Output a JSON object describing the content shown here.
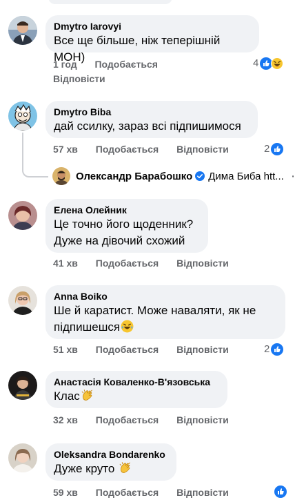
{
  "top_edge": {
    "visible": true
  },
  "comments": [
    {
      "author": "Dmytro Iarovyi",
      "text": "Все ще більше, ніж теперішній МОН)",
      "time": "1 год",
      "like": "Подобається",
      "reply": "Відповісти",
      "reactions": "4",
      "reaction_icons": [
        "like-icon",
        "haha-icon"
      ]
    },
    {
      "author": "Dmytro Biba",
      "text": "дай ссилку, зараз всі підпишимося",
      "time": "57 хв",
      "like": "Подобається",
      "reply": "Відповісти",
      "reactions": "2",
      "reaction_icons": [
        "like-icon"
      ],
      "reply_preview": {
        "author": "Олександр Барабошко",
        "verified": true,
        "text": "Дима Биба htt...",
        "more": "···"
      }
    },
    {
      "author": "Елена Олейник",
      "text_lines": [
        "Це точно його щоденник?",
        "Дуже на дівочий схожий"
      ],
      "time": "41 хв",
      "like": "Подобається",
      "reply": "Відповісти"
    },
    {
      "author": "Anna Boiko",
      "text_lines": [
        "Ше й каратист. Може наваляти, як не",
        "підпишешся"
      ],
      "emoji": "laugh-emoji",
      "time": "51 хв",
      "like": "Подобається",
      "reply": "Відповісти",
      "reactions": "2",
      "reaction_icons": [
        "like-icon"
      ]
    },
    {
      "author": "Анастасія Коваленко-В'язовська",
      "text": "Клас",
      "emoji": "clap-emoji",
      "time": "32 хв",
      "like": "Подобається",
      "reply": "Відповісти"
    },
    {
      "author": "Oleksandra Bondarenko",
      "text": "Дуже круто",
      "emoji": "clap-emoji",
      "time": "59 хв",
      "like": "Подобається",
      "reply": "Відповісти",
      "reactions": "",
      "reaction_icons": [
        "like-icon"
      ]
    }
  ],
  "colors": {
    "bubble": "#f0f2f5",
    "meta": "#65676b",
    "like_blue": "#1877f2",
    "text": "#050505"
  }
}
